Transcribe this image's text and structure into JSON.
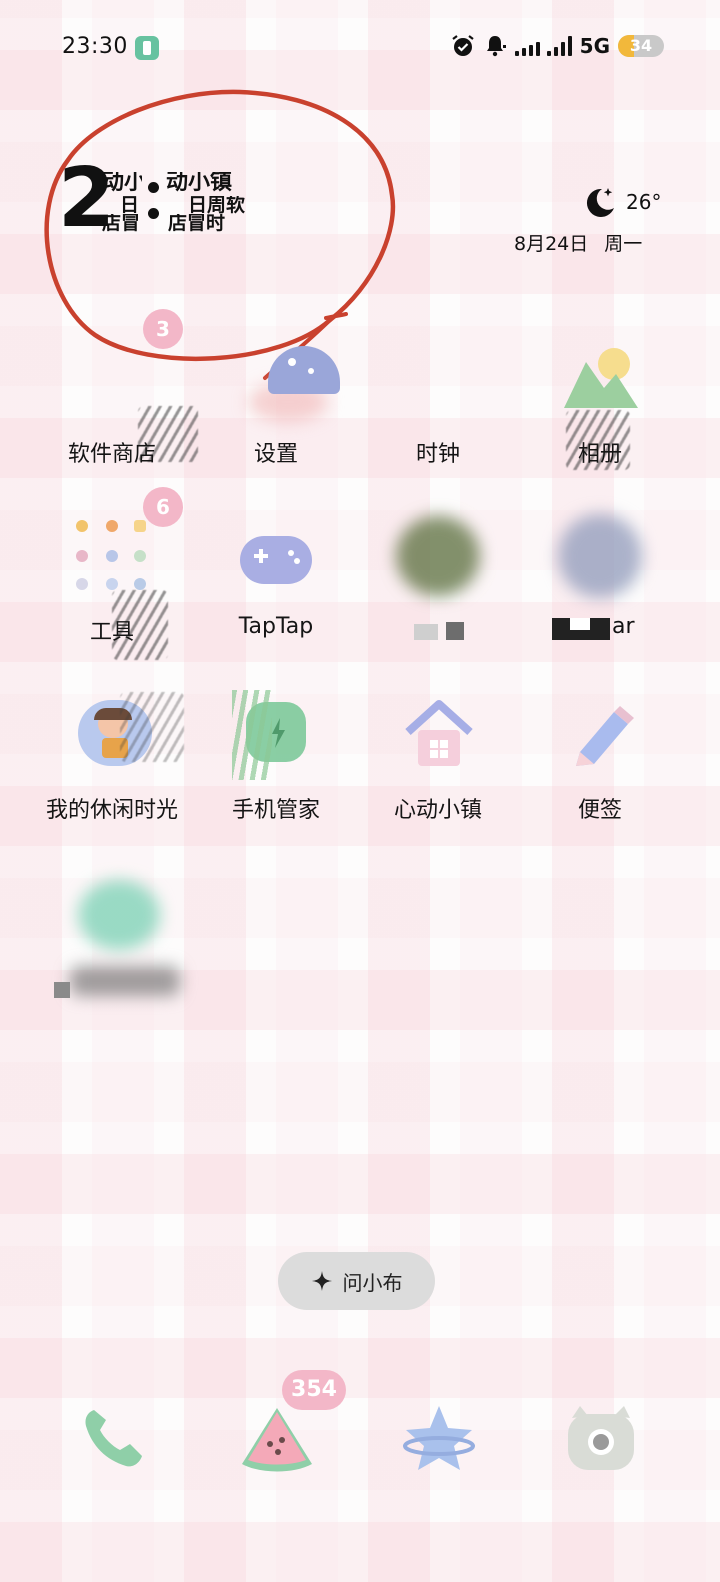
{
  "status_bar": {
    "time": "23:30",
    "network": "5G",
    "battery": "34",
    "battery_level": 0.34
  },
  "widget": {
    "hour": "2",
    "garbled_lines": [
      "动小",
      "日",
      "店冒",
      "动小镇",
      "日周软",
      "店冒时"
    ],
    "temperature": "26°",
    "date": "8月24日  周一"
  },
  "badges": {
    "top_folder": "3",
    "tools_folder": "6",
    "dock_watermelon": "354"
  },
  "apps": {
    "row1": [
      "软件商店",
      "设置",
      "时钟",
      "相册"
    ],
    "row2": [
      "工具",
      "TapTap",
      "",
      "ar"
    ],
    "row3": [
      "我的休闲时光",
      "手机管家",
      "心动小镇",
      "便签"
    ]
  },
  "assistant": {
    "label": "问小布"
  },
  "dock": {
    "items": [
      "phone",
      "watermelon",
      "star",
      "camera"
    ]
  },
  "colors": {
    "annotation_red": "#c9412e",
    "badge_pink": "#f3b7c8"
  }
}
